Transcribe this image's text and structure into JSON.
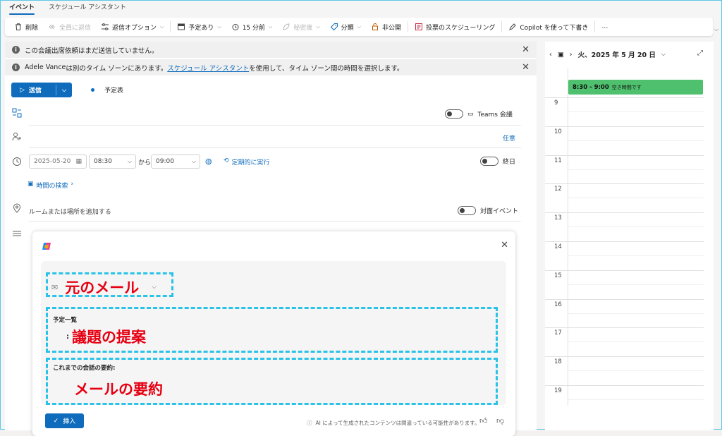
{
  "tabs": [
    {
      "label": "イベント"
    },
    {
      "label": "スケジュール アシスタント"
    }
  ],
  "toolbar": {
    "delete": "削除",
    "reply_all": "全員に返信",
    "response_options": "返信オプション",
    "show_as": "予定あり",
    "reminder": "15 分前",
    "sensitivity": "秘密度",
    "categorize": "分類",
    "private": "非公開",
    "poll": "投票のスケジューリング",
    "copilot_draft": "Copilot を使って下書き",
    "more": "…"
  },
  "banners": {
    "not_sent": "この会議出席依頼はまだ送信していません。",
    "tz_name": "Adele Vance",
    "tz_text1": " は別のタイム ゾーンにあります。",
    "tz_link": "スケジュール アシスタント",
    "tz_text2": " を使用して、タイム ゾーン間の時間を選択します。"
  },
  "send": {
    "label": "送信"
  },
  "calendar_label": "予定表",
  "teams_label": "Teams 会議",
  "optional_label": "任意",
  "date": {
    "start_date": "2025-05-20",
    "start_time": "08:30",
    "from": "から",
    "end_time": "09:00",
    "recurring": "定期的に実行",
    "all_day": "終日"
  },
  "time_search": "時間の検索",
  "location": {
    "placeholder": "ルームまたは場所を追加する",
    "in_person": "対面イベント"
  },
  "copilot": {
    "source_label": "元のメール",
    "agenda_heading": "予定一覧",
    "agenda_label": "議題の提案",
    "summary_heading": "これまでの会話の要約:",
    "summary_label": "メールの要約",
    "insert": "挿入",
    "disclaimer": "AI によって生成されたコンテンツは間違っている可能性があります。"
  },
  "calendar": {
    "date_title": "火、2025 年 5 月 20 日",
    "hours": [
      "9",
      "10",
      "11",
      "12",
      "13",
      "14",
      "15",
      "16",
      "17",
      "18",
      "19"
    ],
    "event_time": "8:30 - 9:00",
    "event_status": "空き時間です"
  },
  "colors": {
    "accent": "#0f6cbd",
    "event": "#4fc16e",
    "annotation": "#29c2e8",
    "annotation_text": "#e60012"
  }
}
